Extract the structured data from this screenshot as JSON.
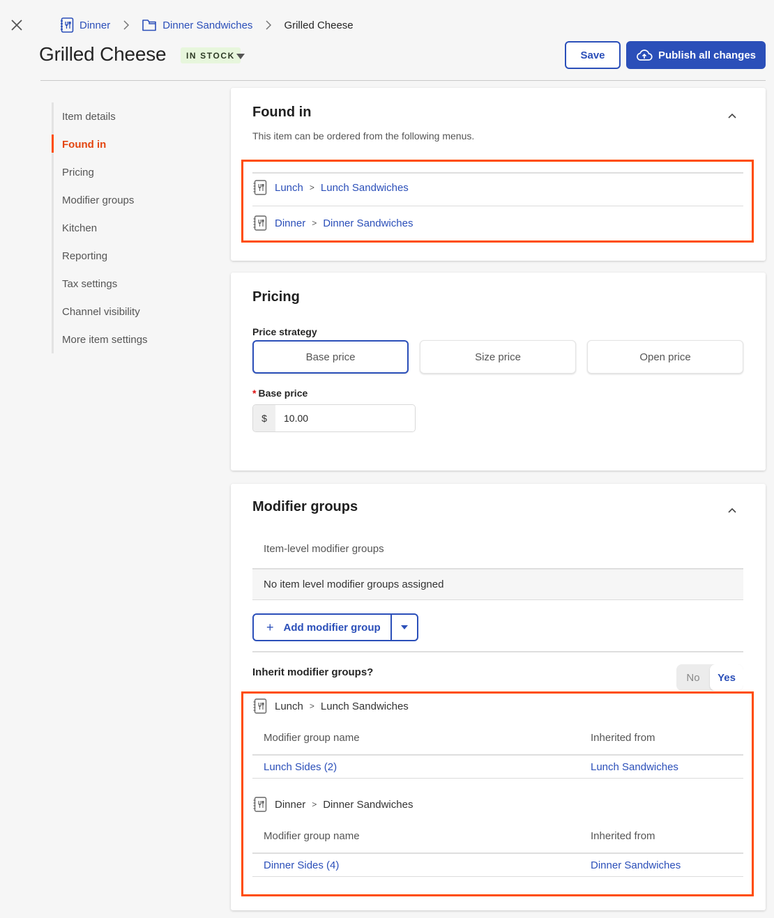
{
  "header": {
    "breadcrumb": [
      {
        "label": "Dinner",
        "icon": "menu-icon"
      },
      {
        "label": "Dinner Sandwiches",
        "icon": "folder-icon"
      },
      {
        "label": "Grilled Cheese"
      }
    ],
    "title": "Grilled Cheese",
    "stock_status": "IN STOCK",
    "save_label": "Save",
    "publish_label": "Publish all changes"
  },
  "sidenav": {
    "active": "Found in",
    "items": [
      {
        "label": "Item details"
      },
      {
        "label": "Found in"
      },
      {
        "label": "Pricing"
      },
      {
        "label": "Modifier groups"
      },
      {
        "label": "Kitchen"
      },
      {
        "label": "Reporting"
      },
      {
        "label": "Tax settings"
      },
      {
        "label": "Channel visibility"
      },
      {
        "label": "More item settings"
      }
    ]
  },
  "found_in": {
    "title": "Found in",
    "description": "This item can be ordered from the following menus.",
    "paths": [
      {
        "menu": "Lunch",
        "sep": ">",
        "group": "Lunch Sandwiches"
      },
      {
        "menu": "Dinner",
        "sep": ">",
        "group": "Dinner Sandwiches"
      }
    ]
  },
  "pricing": {
    "title": "Pricing",
    "strategy_label": "Price strategy",
    "strategies": [
      {
        "label": "Base price",
        "selected": true
      },
      {
        "label": "Size price",
        "selected": false
      },
      {
        "label": "Open price",
        "selected": false
      }
    ],
    "base_price_required": "*",
    "base_price_label": "Base price",
    "currency_symbol": "$",
    "base_price_value": "10.00"
  },
  "modifier_groups": {
    "title": "Modifier groups",
    "item_level_label": "Item-level modifier groups",
    "empty_message": "No item level modifier groups assigned",
    "add_label": "Add modifier group",
    "add_icon": "+",
    "inherit_label": "Inherit modifier groups?",
    "toggle": {
      "no": "No",
      "yes": "Yes",
      "value": "Yes"
    },
    "inherited": [
      {
        "menu": "Lunch",
        "sep": ">",
        "group": "Lunch Sandwiches",
        "col_name": "Modifier group name",
        "col_from": "Inherited from",
        "rows": [
          {
            "name": "Lunch Sides (2)",
            "from": "Lunch Sandwiches"
          }
        ]
      },
      {
        "menu": "Dinner",
        "sep": ">",
        "group": "Dinner Sandwiches",
        "col_name": "Modifier group name",
        "col_from": "Inherited from",
        "rows": [
          {
            "name": "Dinner Sides (4)",
            "from": "Dinner Sandwiches"
          }
        ]
      }
    ]
  },
  "colors": {
    "brand_blue": "#2b4fb9",
    "highlight_orange": "#ff4c00",
    "active_nav": "#e3450f",
    "stock_badge_bg": "#e7f6dc"
  }
}
